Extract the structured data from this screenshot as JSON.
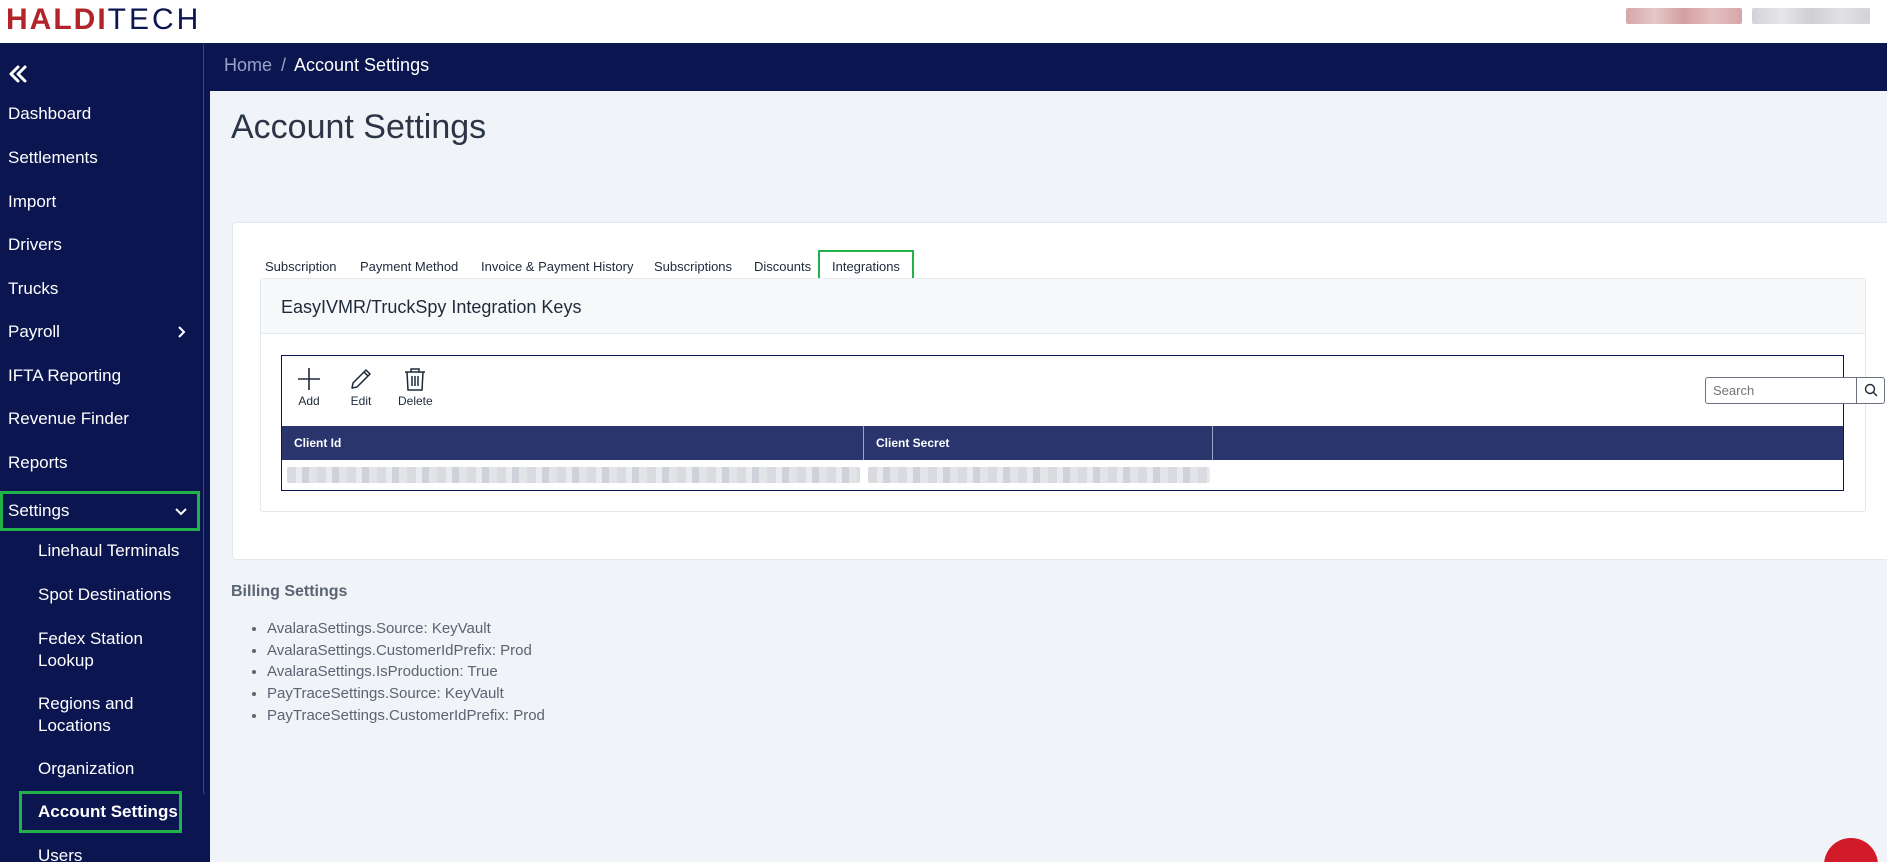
{
  "brand": {
    "part1": "HALDI",
    "part2": "TECH"
  },
  "breadcrumb": {
    "home": "Home",
    "separator": "/",
    "current": "Account Settings"
  },
  "page_title": "Account Settings",
  "sidebar": {
    "items": [
      {
        "label": "Dashboard"
      },
      {
        "label": "Settlements"
      },
      {
        "label": "Import"
      },
      {
        "label": "Drivers"
      },
      {
        "label": "Trucks"
      },
      {
        "label": "Payroll"
      },
      {
        "label": "IFTA Reporting"
      },
      {
        "label": "Revenue Finder"
      },
      {
        "label": "Reports"
      },
      {
        "label": "Settings"
      }
    ],
    "settings_children": [
      {
        "label": "Linehaul Terminals"
      },
      {
        "label": "Spot Destinations"
      },
      {
        "label": "Fedex Station Lookup"
      },
      {
        "label": "Regions and Locations"
      },
      {
        "label": "Organization"
      },
      {
        "label": "Account Settings"
      },
      {
        "label": "Users"
      }
    ]
  },
  "tabs": [
    {
      "label": "Subscription"
    },
    {
      "label": "Payment Method"
    },
    {
      "label": "Invoice & Payment History"
    },
    {
      "label": "Subscriptions"
    },
    {
      "label": "Discounts"
    },
    {
      "label": "Integrations"
    }
  ],
  "integration_panel": {
    "title": "EasyIVMR/TruckSpy Integration Keys",
    "toolbar": {
      "add": "Add",
      "edit": "Edit",
      "delete": "Delete"
    },
    "search_placeholder": "Search",
    "columns": [
      "Client Id",
      "Client Secret"
    ]
  },
  "billing": {
    "title": "Billing Settings",
    "items": [
      "AvalaraSettings.Source: KeyVault",
      "AvalaraSettings.CustomerIdPrefix: Prod",
      "AvalaraSettings.IsProduction: True",
      "PayTraceSettings.Source: KeyVault",
      "PayTraceSettings.CustomerIdPrefix: Prod"
    ]
  },
  "colors": {
    "navy": "#0b1550",
    "grid_header": "#2a356d",
    "active_outline": "#22b24c",
    "brand_red": "#b3232a"
  }
}
